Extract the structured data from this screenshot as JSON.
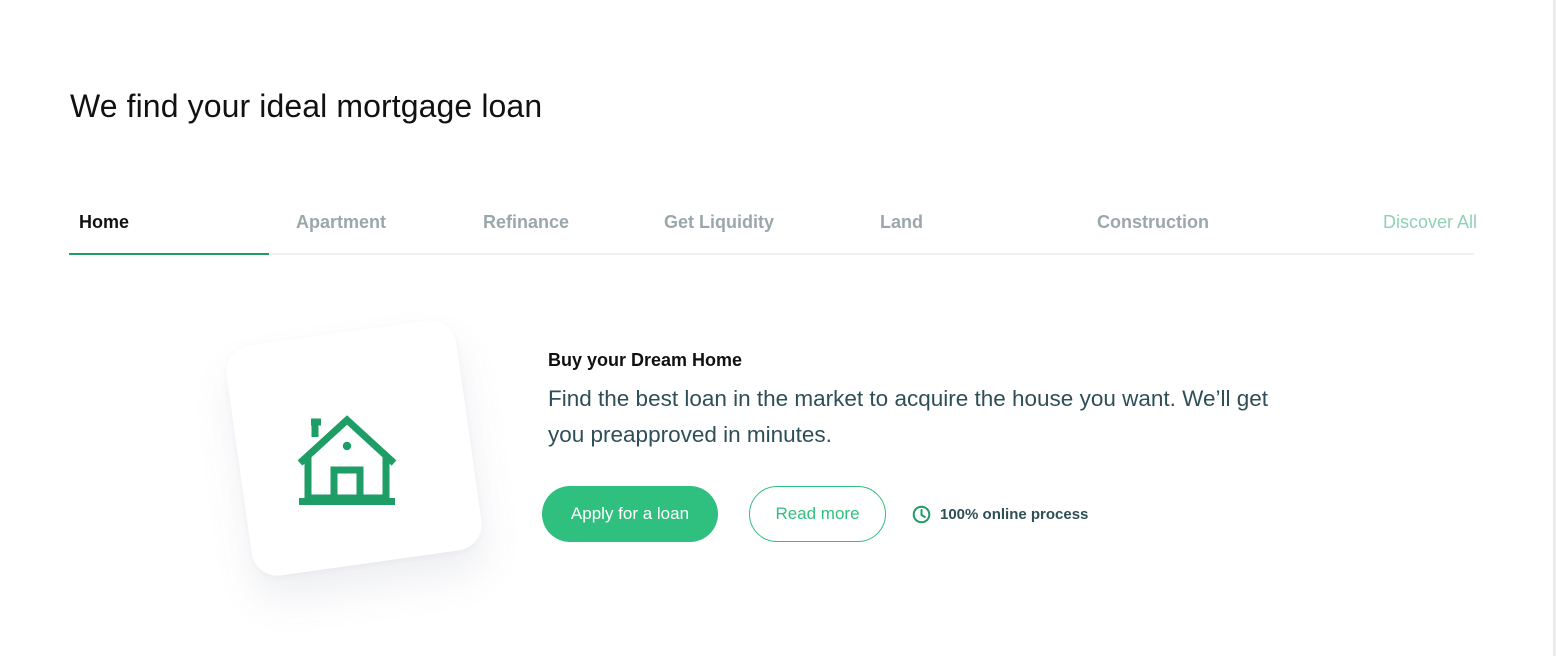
{
  "page_title": "We find your ideal mortgage loan",
  "tabs": [
    {
      "label": "Home"
    },
    {
      "label": "Apartment"
    },
    {
      "label": "Refinance"
    },
    {
      "label": "Get Liquidity"
    },
    {
      "label": "Land"
    },
    {
      "label": "Construction"
    }
  ],
  "active_tab": "Home",
  "discover_all_label": "Discover All",
  "card": {
    "icon": "house-icon"
  },
  "content": {
    "heading": "Buy your Dream Home",
    "description": "Find the best loan in the market to acquire the house you want. We’ll get you preapproved in minutes."
  },
  "buttons": {
    "apply_label": "Apply for a loan",
    "read_more_label": "Read more"
  },
  "online_badge": {
    "icon": "clock-icon",
    "text": "100% online process"
  },
  "colors": {
    "accent": "#2fbf7e",
    "icon_green": "#1f9d66",
    "text_dark": "#111111",
    "text_body": "#2e4f57",
    "tab_inactive": "#9aa7ab",
    "discover_all": "#8fd1b4"
  }
}
